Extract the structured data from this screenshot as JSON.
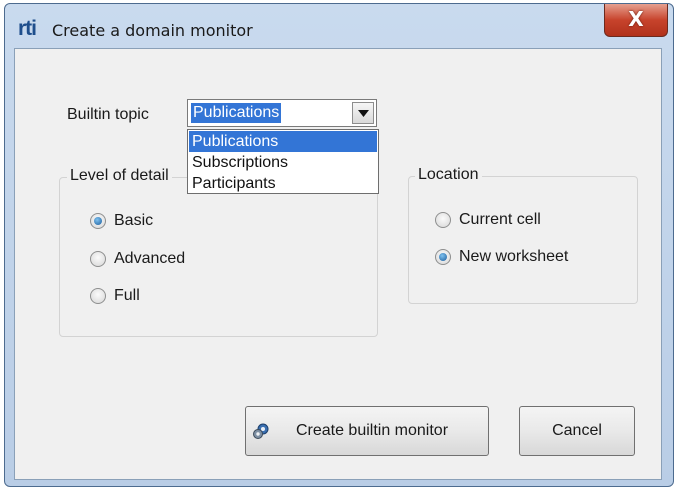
{
  "window": {
    "logo_text": "rti",
    "title": "Create a domain monitor",
    "close_symbol": "X"
  },
  "builtin_topic": {
    "label": "Builtin topic",
    "selected": "Publications",
    "options": [
      "Publications",
      "Subscriptions",
      "Participants"
    ],
    "highlighted_option": "Publications"
  },
  "level_of_detail": {
    "title": "Level of detail",
    "options": [
      {
        "label": "Basic",
        "checked": true
      },
      {
        "label": "Advanced",
        "checked": false
      },
      {
        "label": "Full",
        "checked": false
      }
    ]
  },
  "location": {
    "title": "Location",
    "options": [
      {
        "label": "Current cell",
        "checked": false
      },
      {
        "label": "New worksheet",
        "checked": true
      }
    ]
  },
  "buttons": {
    "create_label": "Create builtin monitor",
    "create_icon": "gears-icon",
    "cancel_label": "Cancel"
  },
  "colors": {
    "selection": "#3375d6",
    "close_button": "#c7432c",
    "title_bar": "#c9daee"
  }
}
